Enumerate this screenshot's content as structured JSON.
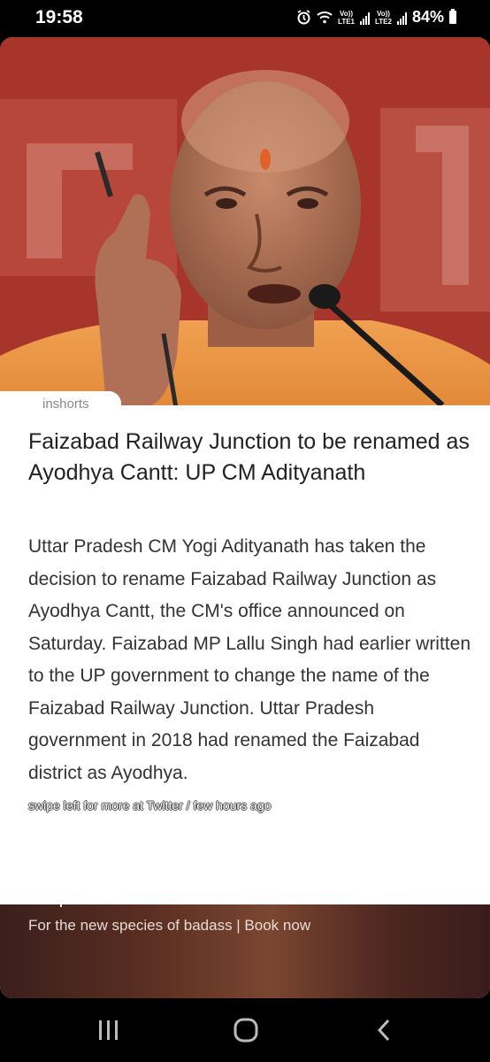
{
  "status_bar": {
    "time": "19:58",
    "net1_top": "Vo))",
    "net1_bottom": "LTE1",
    "net2_top": "Vo))",
    "net2_bottom": "LTE2",
    "battery": "84%"
  },
  "article": {
    "source": "inshorts",
    "headline": "Faizabad Railway Junction to be renamed as Ayodhya Cantt: UP CM Adityanath",
    "body": "Uttar Pradesh CM Yogi Adityanath has taken the decision to rename Faizabad Railway Junction as Ayodhya Cantt, the CM's office announced on Saturday. Faizabad MP Lallu Singh had earlier written to the UP government to change the name of the Faizabad Railway Junction. Uttar Pradesh government in 2018 had renamed the Faizabad district as Ayodhya.",
    "footer": "swipe left for more at Twitter / few hours ago"
  },
  "ad": {
    "title": "KIA presents the all-new Seltos X Line",
    "subtitle": "For the new species of badass | Book now"
  },
  "nav": {
    "icons": [
      "recents-icon",
      "home-icon",
      "back-icon"
    ]
  },
  "colors": {
    "headline": "#222222",
    "body": "#333333",
    "source_badge": "#8a8a8a"
  }
}
